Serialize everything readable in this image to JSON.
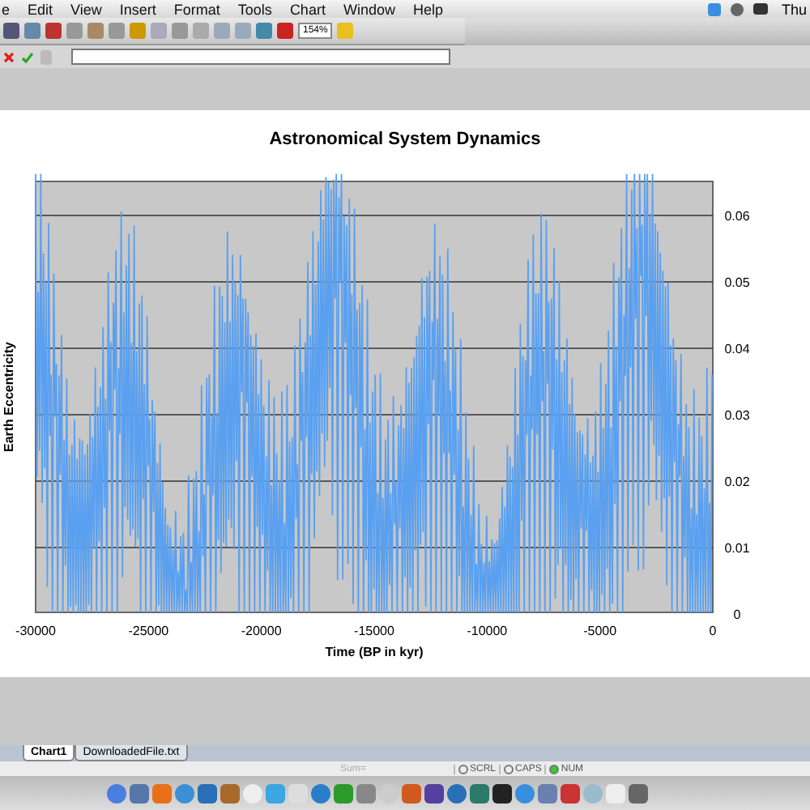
{
  "menu_bar": {
    "items": [
      "e",
      "Edit",
      "View",
      "Insert",
      "Format",
      "Tools",
      "Chart",
      "Window",
      "Help"
    ],
    "clock": "Thu"
  },
  "toolbar": {
    "zoom": "154%"
  },
  "chart": {
    "title": "Astronomical System Dynamics",
    "xlabel": "Time (BP in kyr)",
    "ylabel": "Earth Eccentricity",
    "xticks": [
      "-30000",
      "-25000",
      "-20000",
      "-15000",
      "-10000",
      "-5000",
      "0"
    ],
    "yticks": [
      "0.06",
      "0.05",
      "0.04",
      "0.03",
      "0.02",
      "0.01",
      "0"
    ]
  },
  "sheet_tabs": [
    {
      "label": "Chart1",
      "selected": true
    },
    {
      "label": "DownloadedFile.txt",
      "selected": false
    }
  ],
  "status_bar": {
    "sum": "Sum=",
    "indicators": [
      {
        "label": "SCRL",
        "on": false
      },
      {
        "label": "CAPS",
        "on": false
      },
      {
        "label": "NUM",
        "on": true
      }
    ]
  }
}
